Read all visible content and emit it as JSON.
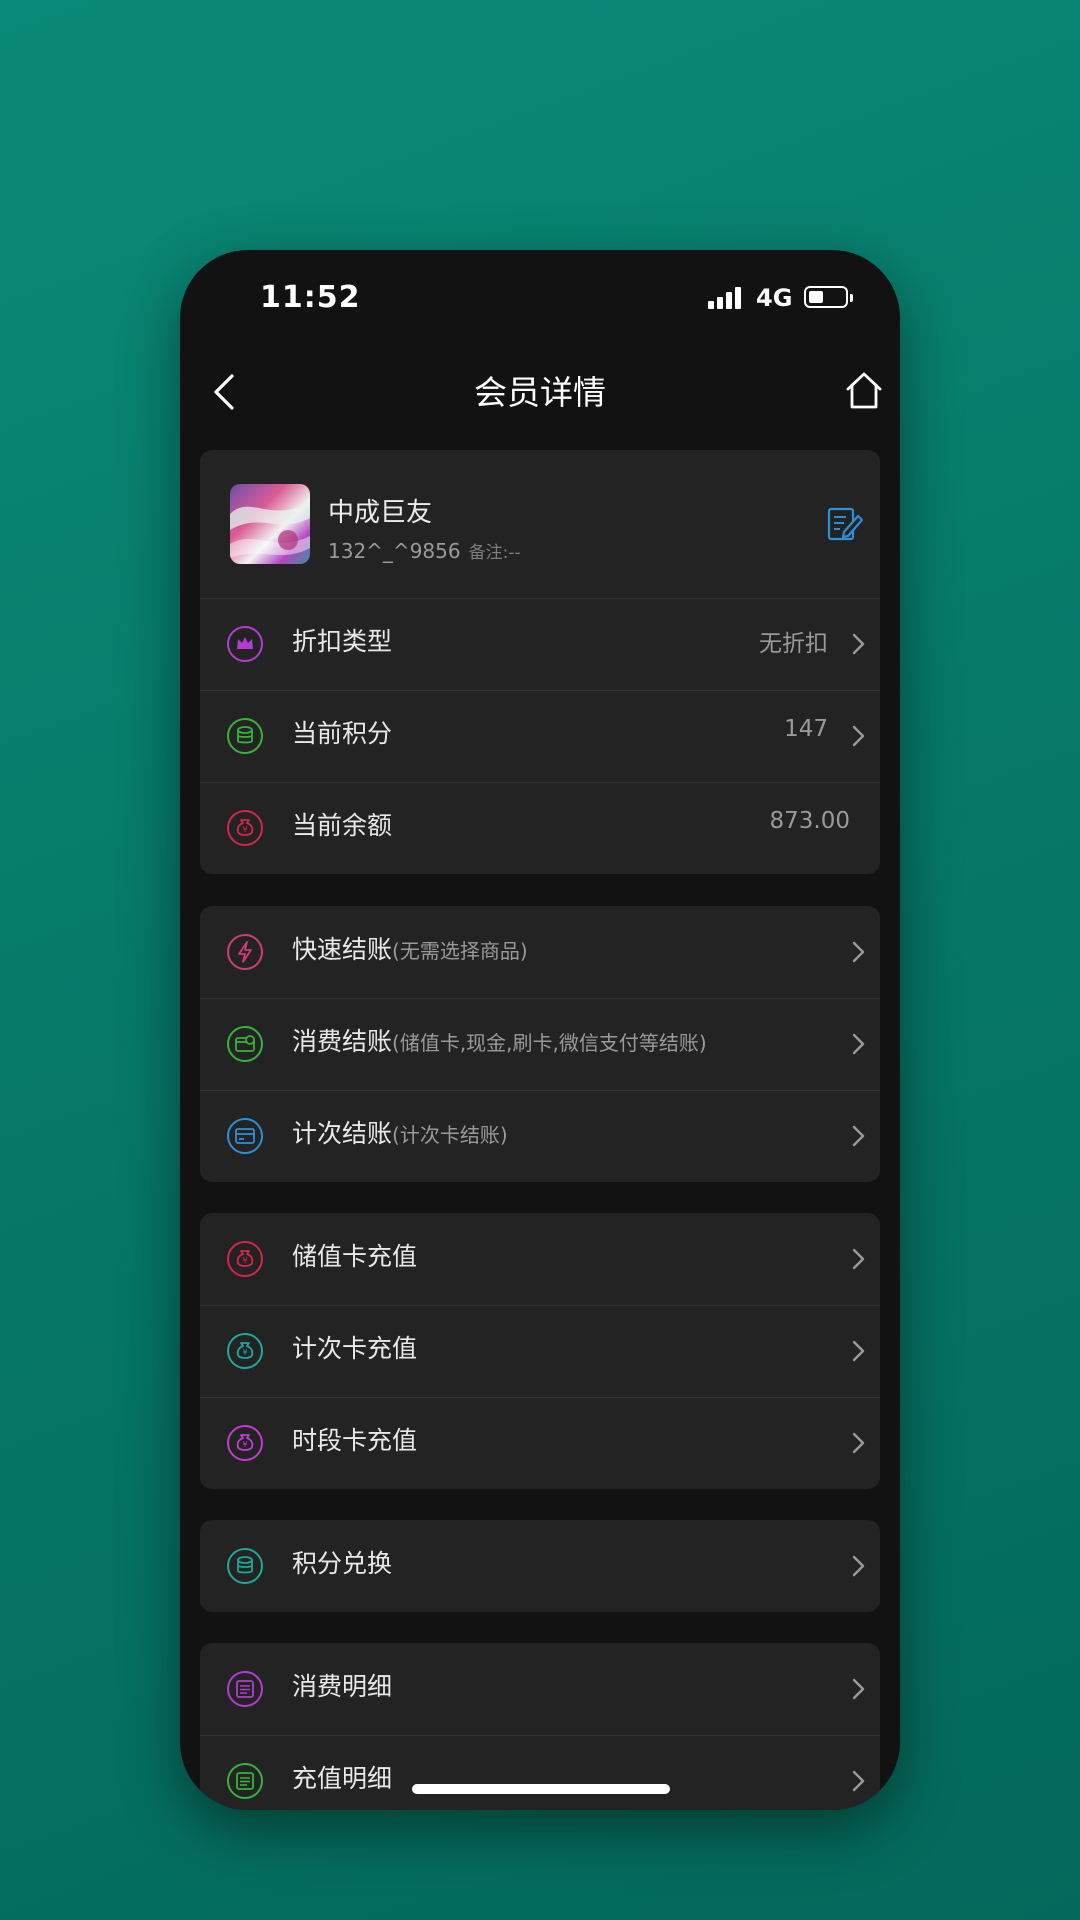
{
  "status_bar": {
    "time": "11:52",
    "network": "4G",
    "battery_level": 0.4
  },
  "header": {
    "title": "会员详情"
  },
  "member": {
    "name": "中成巨友",
    "phone": "132^_^9856",
    "note": "备注:--"
  },
  "info_rows": [
    {
      "label": "折扣类型",
      "value": "无折扣",
      "icon": "crown-icon",
      "color": "#b33bd1"
    },
    {
      "label": "当前积分",
      "value": "147",
      "icon": "coins-icon",
      "color": "#36b33a"
    },
    {
      "label": "当前余额",
      "value": "873.00",
      "icon": "money-bag-icon",
      "color": "#d1284a"
    }
  ],
  "checkout_rows": [
    {
      "label": "快速结账",
      "sub": "(无需选择商品)",
      "icon": "lightning-icon",
      "color": "#d13c77"
    },
    {
      "label": "消费结账",
      "sub": "(储值卡,现金,刷卡,微信支付等结账)",
      "icon": "wallet-icon",
      "color": "#36b33a"
    },
    {
      "label": "计次结账",
      "sub": "(计次卡结账)",
      "icon": "card-icon",
      "color": "#2f8fd6"
    }
  ],
  "recharge_rows": [
    {
      "label": "储值卡充值",
      "icon": "money-bag-icon",
      "color": "#d1284a"
    },
    {
      "label": "计次卡充值",
      "icon": "money-bag-icon",
      "color": "#1ea89a"
    },
    {
      "label": "时段卡充值",
      "icon": "money-bag-icon",
      "color": "#c13bd1"
    }
  ],
  "points_rows": [
    {
      "label": "积分兑换",
      "icon": "coins-icon",
      "color": "#1ea89a"
    }
  ],
  "detail_rows": [
    {
      "label": "消费明细",
      "icon": "list-icon",
      "color": "#b33bd1"
    },
    {
      "label": "充值明细",
      "icon": "list-icon",
      "color": "#36b33a"
    }
  ],
  "colors": {
    "accent_blue": "#2f8fd6",
    "background": "#121212",
    "card": "#232323"
  }
}
